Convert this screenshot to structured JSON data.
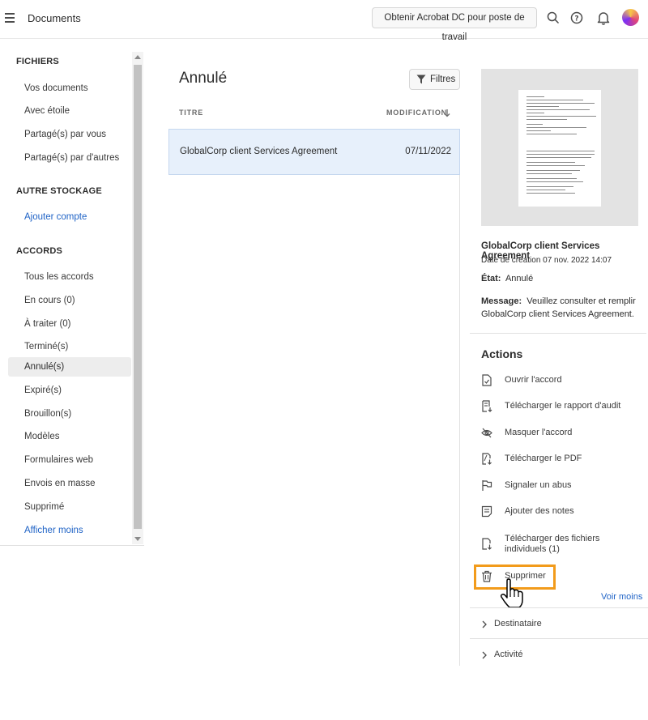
{
  "header": {
    "title": "Documents",
    "get_app_label": "Obtenir Acrobat DC pour poste de travail"
  },
  "sidebar": {
    "files_title": "FICHIERS",
    "files": [
      "Vos documents",
      "Avec étoile",
      "Partagé(s) par vous",
      "Partagé(s) par d'autres"
    ],
    "storage_title": "AUTRE STOCKAGE",
    "add_account": "Ajouter compte",
    "agreements_title": "ACCORDS",
    "agreements": [
      "Tous les accords",
      "En cours (0)",
      "À traiter (0)",
      "Terminé(s)",
      "Annulé(s)",
      "Expiré(s)",
      "Brouillon(s)",
      "Modèles",
      "Formulaires web",
      "Envois en masse",
      "Supprimé"
    ],
    "show_less": "Afficher moins"
  },
  "main": {
    "heading": "Annulé",
    "filter_label": "Filtres",
    "col_title": "TITRE",
    "col_modified": "MODIFICATION",
    "rows": [
      {
        "title": "GlobalCorp client Services Agreement",
        "date": "07/11/2022"
      }
    ]
  },
  "details": {
    "title": "GlobalCorp client Services Agreement",
    "created": "Date de création 07 nov. 2022 14:07",
    "state_label": "État:",
    "state_value": "Annulé",
    "message_label": "Message:",
    "message_value": "Veuillez consulter et remplir GlobalCorp client Services Agreement.",
    "actions_title": "Actions",
    "actions": [
      "Ouvrir l'accord",
      "Télécharger le rapport d'audit",
      "Masquer l'accord",
      "Télécharger le PDF",
      "Signaler un abus",
      "Ajouter des notes",
      "Télécharger des fichiers individuels (1)",
      "Supprimer"
    ],
    "see_less": "Voir moins",
    "recipient": "Destinataire",
    "activity": "Activité"
  },
  "colors": {
    "accent_link": "#1f63c6",
    "selected_row": "#e7f0fb",
    "highlight": "#f29b1b"
  }
}
